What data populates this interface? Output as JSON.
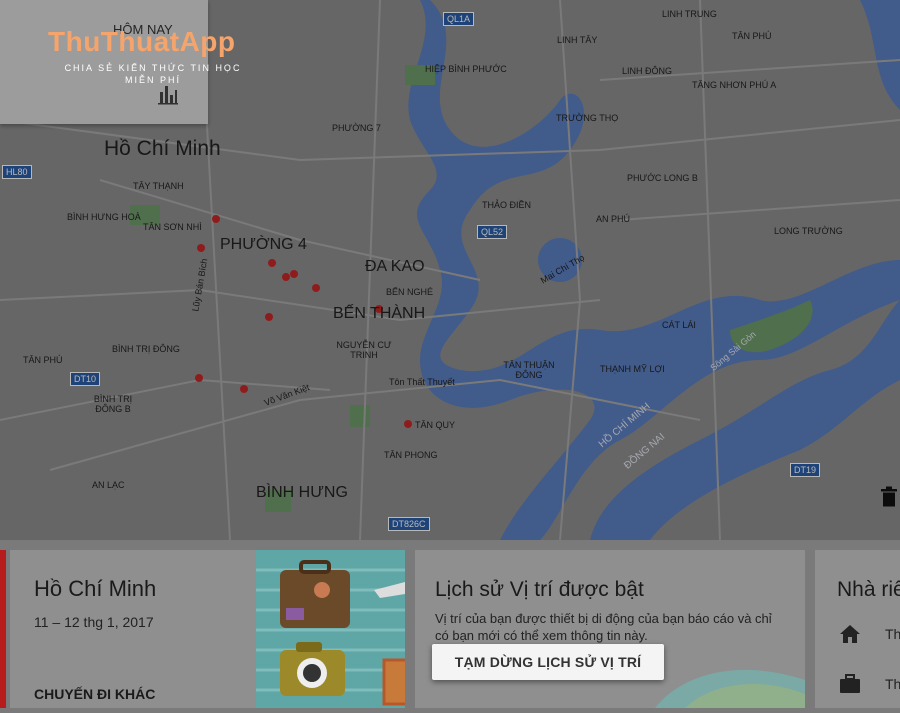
{
  "today_card": {
    "label": "HÔM NAY"
  },
  "watermark": {
    "title": "ThuThuatApp",
    "subtitle": "CHIA SẺ KIẾN THỨC TIN HỌC MIỄN PHÍ"
  },
  "map": {
    "city_label": "Hồ Chí Minh",
    "large_labels": {
      "phuong4": "PHƯỜNG 4",
      "dakao": "ĐA KAO",
      "benthanh": "BẾN THÀNH",
      "binhhung": "BÌNH HƯNG"
    },
    "small_labels": {
      "hom_nay_area": "HIỆP BÌNH PHƯỚC",
      "linh_trung": "LINH TRUNG",
      "linh_tay": "LINH TÂY",
      "tan_phu": "TÂN PHÚ",
      "linh_dong": "LINH ĐÔNG",
      "tang_nhon_phu_a": "TĂNG NHƠN PHÚ A",
      "truong_tho": "TRƯỜNG THỌ",
      "phuong7": "PHƯỜNG 7",
      "tay_thanh": "TÂY THẠNH",
      "binh_hung_hoa": "BÌNH HƯNG HOÀ",
      "tan_son_nhi": "TÂN SƠN NHÌ",
      "thao_dien": "THẢO ĐIỀN",
      "phuoc_long_b": "PHƯỚC LONG B",
      "an_phu": "AN PHÚ",
      "long_truong": "LONG TRƯỜNG",
      "ben_nghe": "BẾN NGHÉ",
      "nguyen_cu_trinh": "NGUYỄN CƯ TRINH",
      "cat_lai": "CÁT LÁI",
      "tan_phu2": "TÂN PHÚ",
      "binh_tri_dong": "BÌNH TRỊ ĐÔNG",
      "tan_thuan_dong": "TÂN THUẬN ĐÔNG",
      "thanh_my_loi": "THẠNH MỸ LỢI",
      "binh_tri_dong_b": "BÌNH TRỊ ĐÔNG B",
      "tan_quy": "TÂN QUY",
      "tan_phong": "TÂN PHONG",
      "an_lac": "AN LẠC",
      "vo_van_kiet": "Võ Văn Kiệt",
      "ton_that_thuyet": "Tôn Thất Thuyết",
      "mai_chi_tho": "Mai Chí Thọ",
      "ho_chi_minh_river": "HỒ CHÍ MINH",
      "dong_nai": "ĐỒNG NAI",
      "song_sai_gon": "Sông Sài Gòn",
      "le_van_luong": "Lê Văn Lương",
      "luy_ban_bich": "Lũy Bán Bích"
    },
    "shields": {
      "ql1a": "QL1A",
      "hl80": "HL80",
      "ql52": "QL52",
      "dt10": "DT10",
      "dt19": "DT19",
      "dt826c": "DT826C"
    },
    "colors": {
      "water": "#5b7fc1",
      "land": "#8e8e8e",
      "park": "#6f9a6a",
      "road": "#a9a9a9",
      "pin": "#c62828"
    }
  },
  "bottom_cards": {
    "trip": {
      "title": "Hồ Chí Minh",
      "dates": "11 – 12 thg 1, 2017",
      "other_trips": "CHUYẾN ĐI KHÁC"
    },
    "history": {
      "title": "Lịch sử Vị trí được bật",
      "desc": "Vị trí của bạn được thiết bị di động của bạn báo cáo và chỉ có bạn mới có thể xem thông tin này.",
      "pause_button": "TẠM DỪNG LỊCH SỬ VỊ TRÍ"
    },
    "places": {
      "title": "Nhà riê",
      "home_text": "Th",
      "work_text": "Th"
    }
  },
  "icons": {
    "today_chart": "bar-chart-icon",
    "delete": "trash-icon",
    "home": "home-icon",
    "work": "briefcase-icon"
  }
}
